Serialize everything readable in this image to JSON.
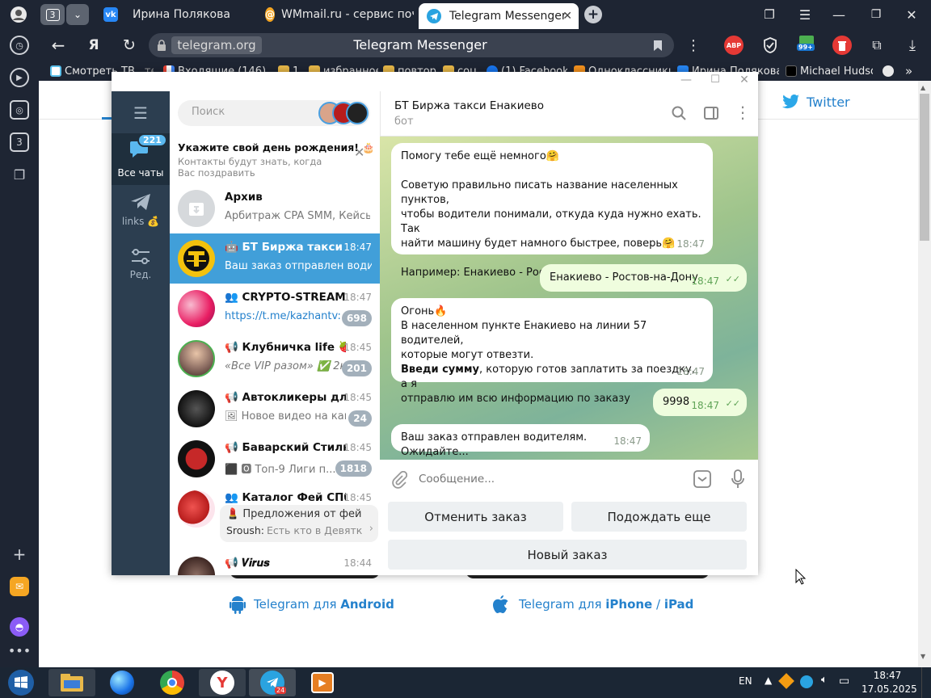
{
  "browser": {
    "tab_counter": "3",
    "tabs": [
      {
        "title": "Ирина Полякова"
      },
      {
        "title": "WMmail.ru - сервис почто"
      },
      {
        "title": "Telegram Messenger"
      }
    ],
    "address_domain": "telegram.org",
    "page_title": "Telegram Messenger",
    "ext_abp": "ABP",
    "ext_badge": "99+",
    "bookmarks": [
      {
        "label": "Смотреть ТВ",
        "trail": "те"
      },
      {
        "label": "Входящие (146)"
      },
      {
        "label": "1"
      },
      {
        "label": "избранное"
      },
      {
        "label": "повтор"
      },
      {
        "label": "соц"
      },
      {
        "label": "(1) Facebook"
      },
      {
        "label": "Одноклассники"
      },
      {
        "label": "Ирина Полякова"
      },
      {
        "label": "Michael Hudso"
      }
    ],
    "sidebar_counter": "3"
  },
  "site": {
    "twitter_label": "Twitter",
    "android_prefix": "Telegram для ",
    "android_os": "Android",
    "ios_prefix": "Telegram для ",
    "ios_iphone": "iPhone",
    "ios_sep": " / ",
    "ios_ipad": "iPad"
  },
  "telegram": {
    "left_nav": {
      "all_chats_label": "Все чаты",
      "all_chats_badge": "221",
      "links_label": "links 💰",
      "edit_label": "Ред."
    },
    "search_placeholder": "Поиск",
    "birthday": {
      "title": "Укажите свой день рождения! 🎂",
      "subtitle": "Контакты будут знать, когда Вас поздравить"
    },
    "chats": [
      {
        "name": "Архив",
        "time": "",
        "preview": "Арбитраж CPA SMM, Кейсы ...",
        "badge": ""
      },
      {
        "name": "🤖 БТ Биржа такси Е...",
        "time": "18:47",
        "preview": "Ваш заказ отправлен водит...",
        "badge": ""
      },
      {
        "name": "👥 CRYPTO-STREAMI...",
        "time": "18:47",
        "preview": "https://t.me/kazhantv:",
        "badge": "698"
      },
      {
        "name": "📢 Клубничка life 🍓",
        "time": "18:45",
        "preview": "«Все VIP разом» ✅ 2к...",
        "badge": "201"
      },
      {
        "name": "📢 Автокликеры для...",
        "time": "18:45",
        "preview": "🖼 Новое видео на кан...",
        "badge": "24"
      },
      {
        "name": "📢 Баварский Стиль...",
        "time": "18:45",
        "preview": "⬛ 🅾 Топ-9 Лиги п...",
        "badge": "1818"
      },
      {
        "name": "👥 Каталог Фей СПб",
        "time": "18:45",
        "preview_top": "💄 Предложения от фей",
        "preview_sender": "Sroush:",
        "preview": " Есть кто в Девятки...",
        "badge": ""
      },
      {
        "name": "📢 𝑽𝒊𝒓𝒖𝒔",
        "time": "18:44",
        "preview": "",
        "badge": ""
      }
    ],
    "chat_header": {
      "title": "БТ Биржа такси Енакиево",
      "status": "бот"
    },
    "messages": [
      {
        "dir": "in",
        "lines": [
          "Помогу тебе ещё немного🤗",
          "",
          "Советую правильно писать название населенных пунктов,",
          "чтобы водители понимали, откуда куда нужно ехать. Так",
          "найти машину будет намного быстрее, поверь🤗",
          "",
          "Например: Енакиево - Ростов-на-Дону"
        ],
        "time": "18:47"
      },
      {
        "dir": "out",
        "lines": [
          "Енакиево - Ростов-на-Дону"
        ],
        "time": "18:47"
      },
      {
        "dir": "in",
        "lines": [
          "Огонь🔥",
          "В населенном пункте Енакиево на линии 57  водителей,",
          "которые могут отвезти."
        ],
        "bold_part": "Введи сумму",
        "rest": ", которую готов заплатить за поездку, а я",
        "last_line": "отправлю им всю информацию по заказу",
        "time": "18:47"
      },
      {
        "dir": "out",
        "lines": [
          "9998"
        ],
        "time": "18:47"
      },
      {
        "dir": "in",
        "lines": [
          "Ваш заказ отправлен водителям. Ожидайте..."
        ],
        "time": "18:47"
      }
    ],
    "composer_placeholder": "Сообщение...",
    "keyboard": {
      "cancel": "Отменить заказ",
      "wait": "Подождать еще",
      "new_order": "Новый заказ"
    }
  },
  "taskbar": {
    "lang": "EN",
    "time": "18:47",
    "date": "17.05.2025",
    "telegram_badge": "24"
  }
}
